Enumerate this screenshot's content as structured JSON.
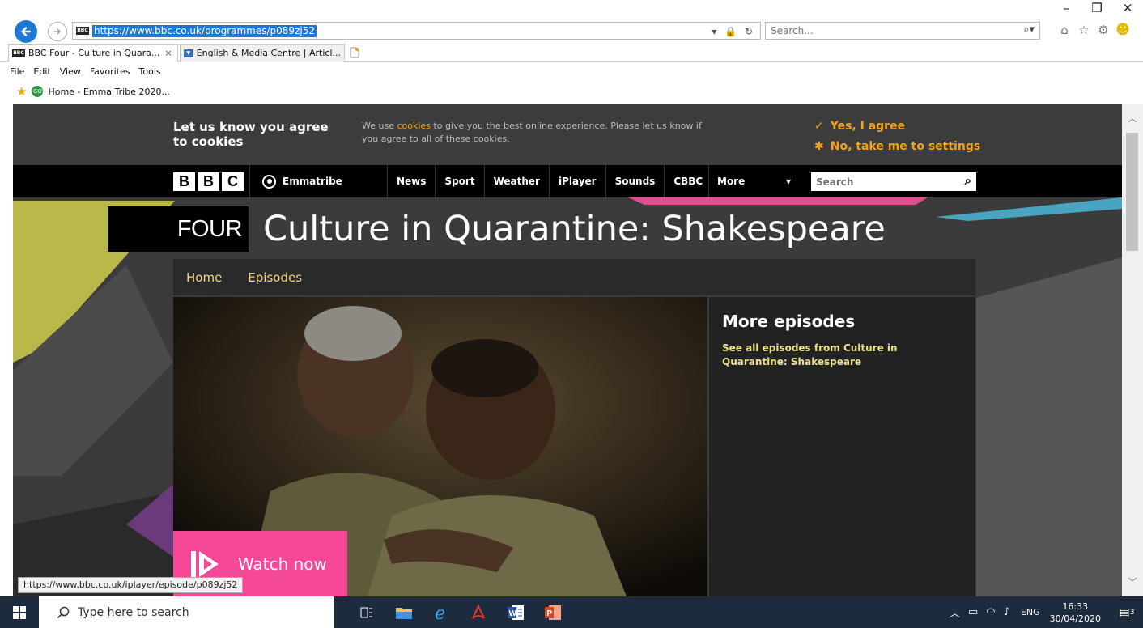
{
  "window": {
    "minimize": "–",
    "restore": "❐",
    "close": "✕"
  },
  "address_bar": {
    "url": "https://www.bbc.co.uk/programmes/p089zj52",
    "icons": "▾ 🔒 ↻",
    "search_placeholder": "Search..."
  },
  "tabs": [
    {
      "label": "BBC Four - Culture in Quara...",
      "close": "×"
    },
    {
      "label": "English & Media Centre | Articl..."
    }
  ],
  "menu": [
    "File",
    "Edit",
    "View",
    "Favorites",
    "Tools"
  ],
  "favorites": {
    "item": "Home - Emma Tribe 2020..."
  },
  "cookie": {
    "title": "Let us know you agree to cookies",
    "text_before": "We use ",
    "link": "cookies",
    "text_after": " to give you the best online experience. Please let us know if you agree to all of these cookies.",
    "agree": "Yes, I agree",
    "settings": "No, take me to settings"
  },
  "bbc_nav": {
    "logo": [
      "B",
      "B",
      "C"
    ],
    "account": "Emmatribe",
    "items": [
      "News",
      "Sport",
      "Weather",
      "iPlayer",
      "Sounds",
      "CBBC"
    ],
    "more": "More",
    "search_placeholder": "Search"
  },
  "programme": {
    "channel": "FOUR",
    "title": "Culture in Quarantine: Shakespeare",
    "subnav": [
      "Home",
      "Episodes"
    ],
    "watch_now": "Watch now",
    "more_episodes_title": "More episodes",
    "more_episodes_link": "See all episodes from Culture in Quarantine: Shakespeare"
  },
  "status_bar": {
    "url": "https://www.bbc.co.uk/iplayer/episode/p089zj52"
  },
  "taskbar": {
    "search_placeholder": "Type here to search",
    "language": "ENG",
    "time": "16:33",
    "date": "30/04/2020",
    "notifications": "3"
  },
  "colors": {
    "accent_blue": "#1e78d6",
    "cookie_orange": "#f4a21a",
    "watch_pink": "#f54997",
    "subnav_gold": "#f0d68a"
  }
}
